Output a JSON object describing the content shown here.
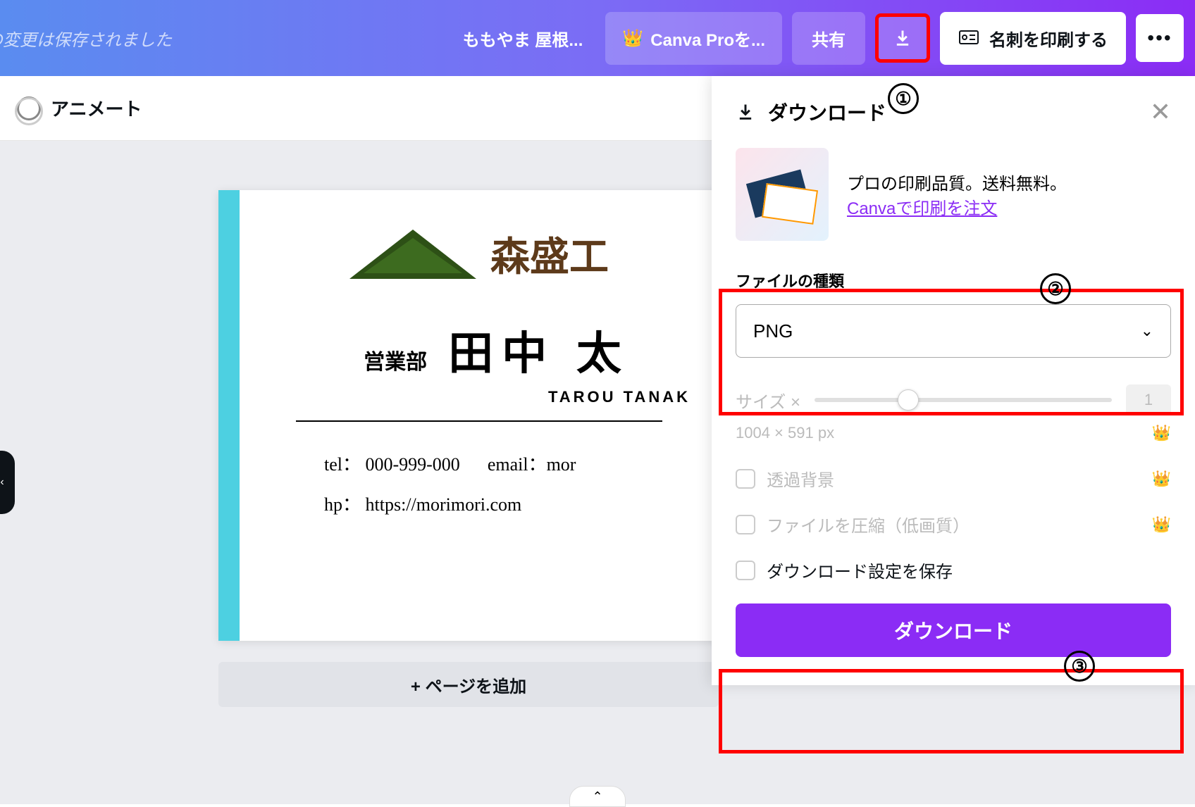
{
  "header": {
    "saved_status": "ての変更は保存されました",
    "design_title": "ももやま 屋根...",
    "pro_button": "Canva Proを...",
    "share_button": "共有",
    "print_button": "名刺を印刷する"
  },
  "sub_toolbar": {
    "animate": "アニメート"
  },
  "canvas": {
    "company": "森盛工",
    "department": "営業部",
    "name_jp": "田中 太",
    "name_en": "TAROU TANAK",
    "tel": "tel： 000-999-000",
    "email": "email：mor",
    "hp": "hp： https://morimori.com",
    "add_page": "+ ページを追加"
  },
  "download_panel": {
    "title": "ダウンロード",
    "promo_text": "プロの印刷品質。送料無料。",
    "promo_link": "Canvaで印刷を注文",
    "file_type_label": "ファイルの種類",
    "file_type_value": "PNG",
    "size_label": "サイズ ×",
    "size_value": "1",
    "dimensions": "1004 × 591 px",
    "option_transparent": "透過背景",
    "option_compress": "ファイルを圧縮（低画質）",
    "option_save_settings": "ダウンロード設定を保存",
    "download_button": "ダウンロード"
  },
  "annotations": {
    "one": "①",
    "two": "②",
    "three": "③"
  }
}
